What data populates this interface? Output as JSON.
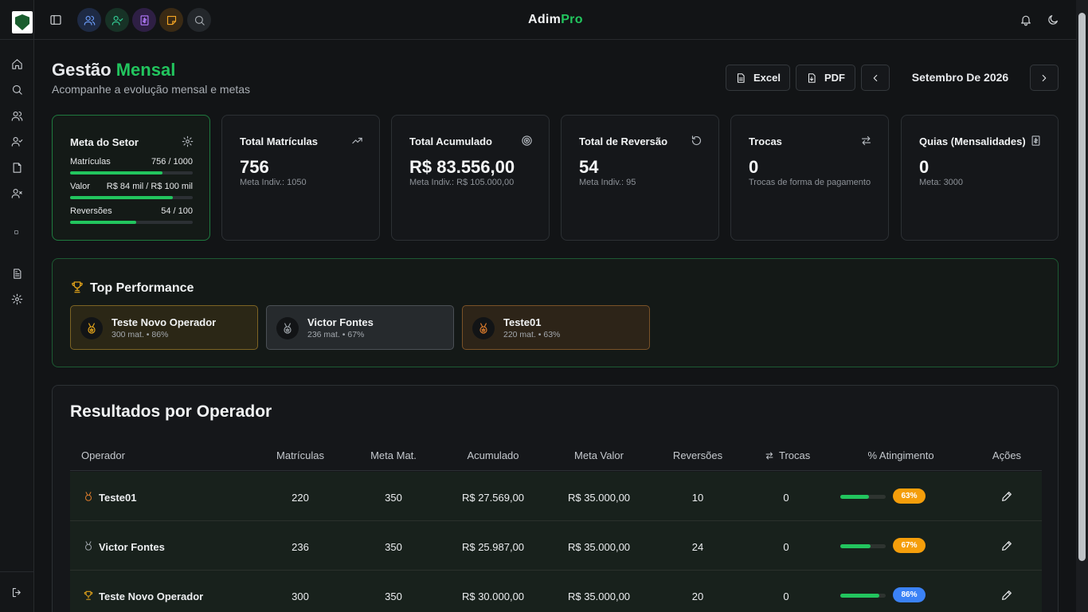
{
  "app": {
    "brand_a": "Adim",
    "brand_b": "Pro"
  },
  "colors": {
    "accent": "#22c55e",
    "gold": "#e0a21a",
    "silver": "#9aa0a6",
    "bronze": "#d97a2b",
    "pill_orange": "#f59e0b",
    "pill_blue": "#3b82f6"
  },
  "sidebar": {
    "items": [
      "home-icon",
      "search-icon",
      "users-icon",
      "user-check-icon",
      "file-icon",
      "user-x-icon",
      "report-icon",
      "settings-icon",
      "logout-icon"
    ]
  },
  "header": {
    "title_a": "Gestão",
    "title_b": "Mensal",
    "subtitle": "Acompanhe a evolução mensal e metas",
    "excel_label": "Excel",
    "pdf_label": "PDF",
    "month_label": "Setembro De 2026"
  },
  "meta_card": {
    "title": "Meta do Setor",
    "rows": [
      {
        "label": "Matrículas",
        "value": "756 / 1000",
        "progress": 0.756
      },
      {
        "label": "Valor",
        "value": "R$ 84 mil / R$ 100 mil",
        "progress": 0.84
      },
      {
        "label": "Reversões",
        "value": "54 / 100",
        "progress": 0.54
      }
    ]
  },
  "stat_cards": [
    {
      "title": "Total Matrículas",
      "value": "756",
      "sub": "Meta Indiv.: 1050",
      "icon": "trending-up-icon"
    },
    {
      "title": "Total Acumulado",
      "value": "R$ 83.556,00",
      "sub": "Meta Indiv.: R$ 105.000,00",
      "icon": "target-icon"
    },
    {
      "title": "Total de Reversão",
      "value": "54",
      "sub": "Meta Indiv.: 95",
      "icon": "rotate-icon"
    },
    {
      "title": "Trocas",
      "value": "0",
      "sub": "Trocas de forma de pagamento",
      "icon": "swap-icon"
    },
    {
      "title": "Quias (Mensalidades)",
      "value": "0",
      "sub": "Meta: 3000",
      "icon": "receipt-icon"
    }
  ],
  "top_performance": {
    "title": "Top Performance",
    "items": [
      {
        "name": "Teste Novo Operador",
        "stats": "300 mat.  •  86%",
        "medal": "gold"
      },
      {
        "name": "Victor Fontes",
        "stats": "236 mat.  •  67%",
        "medal": "silver"
      },
      {
        "name": "Teste01",
        "stats": "220 mat.  •  63%",
        "medal": "bronze"
      }
    ]
  },
  "results": {
    "title": "Resultados por Operador",
    "headers": [
      "Operador",
      "Matrículas",
      "Meta Mat.",
      "Acumulado",
      "Meta Valor",
      "Reversões",
      "Trocas",
      "% Atingimento",
      "Ações"
    ],
    "rows": [
      {
        "operador": "Teste01",
        "matriculas": "220",
        "meta_mat": "350",
        "acumulado": "R$ 27.569,00",
        "meta_valor": "R$ 35.000,00",
        "reversoes": "10",
        "trocas": "0",
        "pct": "63%",
        "progress": 0.63,
        "medal": "bronze"
      },
      {
        "operador": "Victor Fontes",
        "matriculas": "236",
        "meta_mat": "350",
        "acumulado": "R$ 25.987,00",
        "meta_valor": "R$ 35.000,00",
        "reversoes": "24",
        "trocas": "0",
        "pct": "67%",
        "progress": 0.67,
        "medal": "silver"
      },
      {
        "operador": "Teste Novo Operador",
        "matriculas": "300",
        "meta_mat": "350",
        "acumulado": "R$ 30.000,00",
        "meta_valor": "R$ 35.000,00",
        "reversoes": "20",
        "trocas": "0",
        "pct": "86%",
        "progress": 0.86,
        "medal": "gold"
      }
    ]
  }
}
